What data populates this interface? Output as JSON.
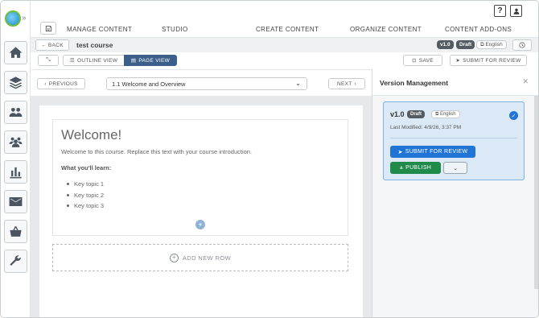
{
  "rail": {
    "items": [
      {
        "name": "home-icon"
      },
      {
        "name": "layers-icon"
      },
      {
        "name": "users-icon"
      },
      {
        "name": "groups-icon"
      },
      {
        "name": "reports-icon"
      },
      {
        "name": "mail-icon"
      },
      {
        "name": "shop-icon"
      },
      {
        "name": "tools-icon"
      }
    ]
  },
  "topnav": {
    "items": [
      "MANAGE CONTENT",
      "STUDIO",
      "CREATE CONTENT",
      "ORGANIZE CONTENT",
      "CONTENT ADD-ONS"
    ],
    "help_label": "?"
  },
  "crumb": {
    "back_label": "BACK",
    "course_title": "test course",
    "version": "v1.0",
    "status": "Draft",
    "language": "English"
  },
  "viewbar": {
    "outline_label": "OUTLINE VIEW",
    "page_label": "PAGE VIEW",
    "save_label": "SAVE",
    "submit_label": "SUBMIT FOR REVIEW"
  },
  "pagenav": {
    "prev_label": "PREVIOUS",
    "next_label": "NEXT",
    "selected_page": "1.1 Welcome and Overview"
  },
  "content": {
    "heading": "Welcome!",
    "intro": "Welcome to this course. Replace this text with your course introduction.",
    "learn_heading": "What you'll learn:",
    "topics": [
      "Key topic 1",
      "Key topic 2",
      "Key topic 3"
    ],
    "add_row_label": "ADD NEW ROW"
  },
  "version_panel": {
    "title": "Version Management",
    "card": {
      "version": "v1.0",
      "status": "Draft",
      "language": "English",
      "last_modified": "Last Modified: 4/9/26, 3:37 PM",
      "submit_label": "SUBMIT FOR REVIEW",
      "publish_label": "PUBLISH",
      "selected": true
    }
  },
  "colors": {
    "primary_blue": "#1f74d6",
    "publish_green": "#1f8a4a",
    "active_tab": "#3b5f8a",
    "draft_badge": "#555b62"
  }
}
